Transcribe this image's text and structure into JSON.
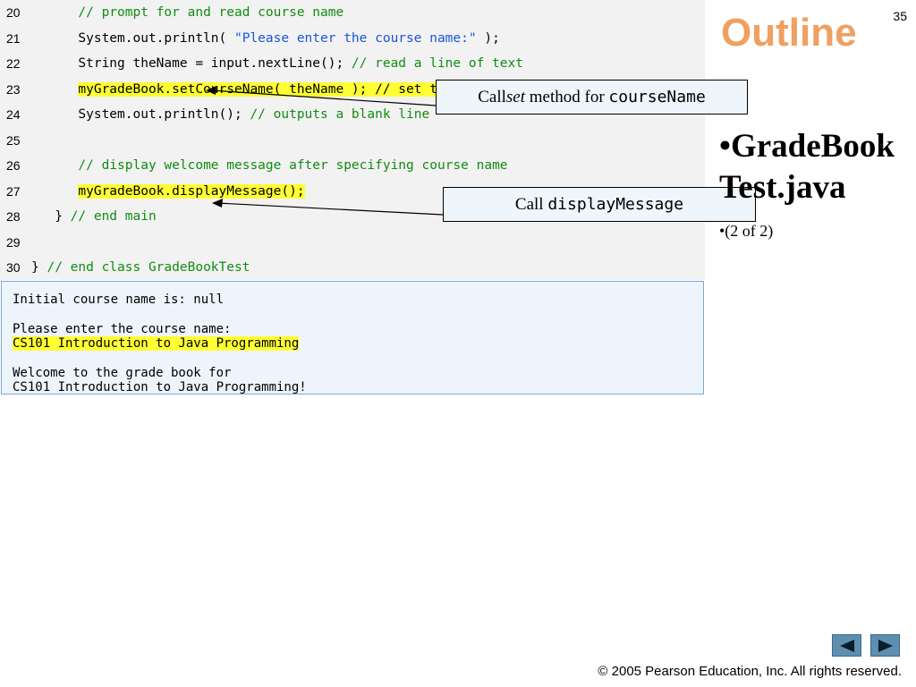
{
  "slide_number": "35",
  "outline_title": "Outline",
  "side_bullet": "•GradeBookTest.java",
  "side_sub": "•(2 of 2)",
  "code_lines": [
    {
      "num": "20",
      "parts": [
        {
          "t": "      "
        },
        {
          "t": "// prompt for and read course name",
          "c": "cm"
        }
      ]
    },
    {
      "num": "21",
      "parts": [
        {
          "t": "      System.out.println( "
        },
        {
          "t": "\"Please enter the course name:\"",
          "c": "st"
        },
        {
          "t": " );"
        }
      ]
    },
    {
      "num": "22",
      "parts": [
        {
          "t": "      String theName = input.nextLine(); "
        },
        {
          "t": "// read a line of text",
          "c": "cm"
        }
      ]
    },
    {
      "num": "23",
      "parts": [
        {
          "t": "      "
        },
        {
          "t": "myGradeBook.setCourseName( theName ); // set the course name",
          "c": "hl"
        }
      ]
    },
    {
      "num": "24",
      "parts": [
        {
          "t": "      System.out.println(); "
        },
        {
          "t": "// outputs a blank line",
          "c": "cm"
        }
      ]
    },
    {
      "num": "25",
      "parts": [
        {
          "t": ""
        }
      ]
    },
    {
      "num": "26",
      "parts": [
        {
          "t": "      "
        },
        {
          "t": "// display welcome message after specifying course name",
          "c": "cm"
        }
      ]
    },
    {
      "num": "27",
      "parts": [
        {
          "t": "      "
        },
        {
          "t": "myGradeBook.displayMessage();",
          "c": "hl"
        }
      ]
    },
    {
      "num": "28",
      "parts": [
        {
          "t": "   } "
        },
        {
          "t": "// end main",
          "c": "cm"
        }
      ]
    },
    {
      "num": "29",
      "parts": [
        {
          "t": ""
        }
      ]
    },
    {
      "num": "30",
      "parts": [
        {
          "t": "} "
        },
        {
          "t": "// end class GradeBookTest",
          "c": "cm"
        }
      ]
    }
  ],
  "output_lines": [
    {
      "t": "Initial course name is: null"
    },
    {
      "t": ""
    },
    {
      "t": "Please enter the course name:"
    },
    {
      "t": "CS101 Introduction to Java Programming",
      "hl": true
    },
    {
      "t": ""
    },
    {
      "t": "Welcome to the grade book for"
    },
    {
      "t": "CS101 Introduction to Java Programming!"
    }
  ],
  "callout_set": {
    "prefix": "Call ",
    "italic": "set",
    "middle": " method for ",
    "code": "courseName"
  },
  "callout_display": {
    "prefix": "Call ",
    "code": "displayMessage"
  },
  "nav": {
    "prev_icon": "left-triangle-icon",
    "next_icon": "right-triangle-icon"
  },
  "copyright": "© 2005 Pearson Education, Inc.  All rights reserved.",
  "colors": {
    "comment": "#118c11",
    "string": "#1a55d6",
    "highlight": "#ffff33",
    "title": "#f0a060",
    "nav": "#5e8eb0"
  }
}
